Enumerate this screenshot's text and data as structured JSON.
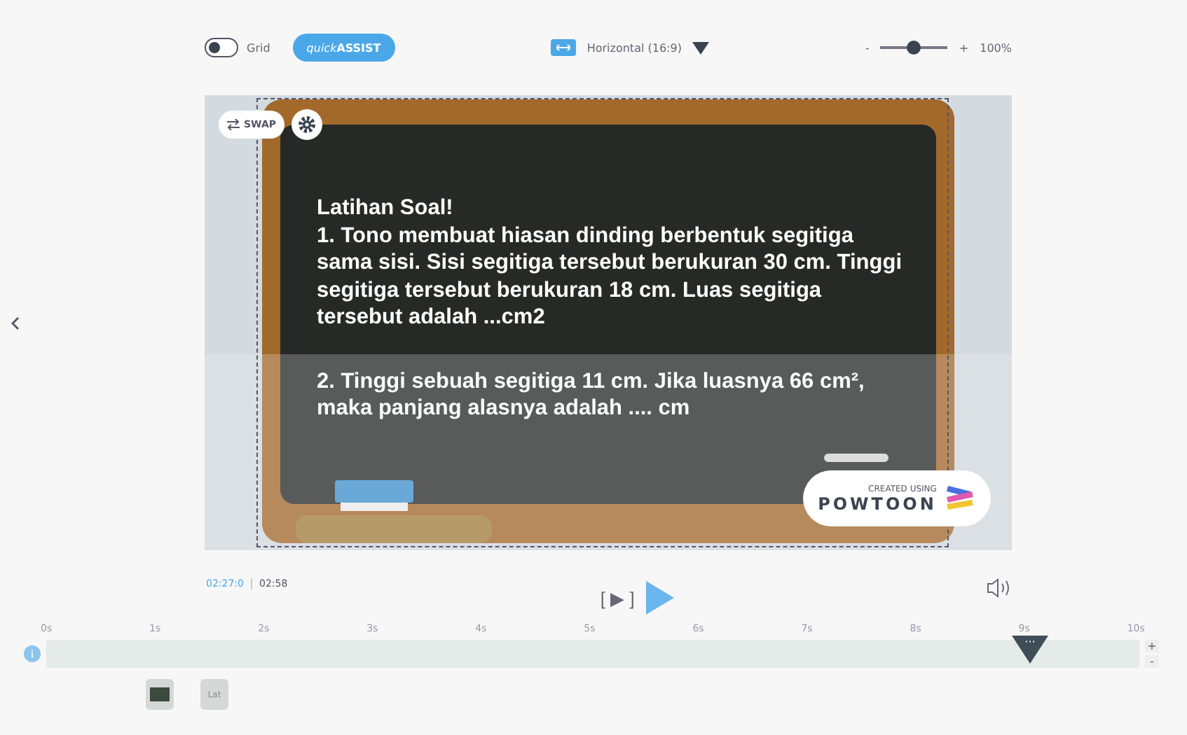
{
  "toolbar": {
    "grid_toggle": {
      "label": "Grid",
      "on": false
    },
    "assist_button": {
      "prefix": "quick",
      "label": "ASSIST"
    },
    "orientation": {
      "label": "Horizontal (16:9)"
    },
    "zoom": {
      "minus": "-",
      "plus": "+",
      "level": 0.5,
      "reading": "100%"
    }
  },
  "stage": {
    "swap_button": "SWAP",
    "slide_texts": [
      {
        "kind": "title",
        "text": "Latihan Soal!"
      },
      {
        "kind": "body",
        "text": "1. Tono membuat hiasan dinding berbentuk segitiga sama sisi. Sisi segitiga tersebut berukuran 30 cm. Tinggi segitiga tersebut berukuran 18 cm. Luas segitiga tersebut adalah ...cm2"
      },
      {
        "kind": "gap",
        "text": "2. Tinggi sebuah segitiga 11 cm. Jika luasnya 66 cm², maka panjang alasnya adalah .... cm"
      }
    ],
    "badge": {
      "caption": "CREATED USING",
      "brand": "POWTOON"
    }
  },
  "player": {
    "current_time": "02:27:0",
    "total_time": "02:58",
    "preview_button": "[ ▶ ]"
  },
  "timeline": {
    "ticks": [
      "0s",
      "1s",
      "2s",
      "3s",
      "4s",
      "5s",
      "6s",
      "7s",
      "8s",
      "9s",
      "10s"
    ],
    "playhead_label": "···",
    "zoom_in": "+",
    "zoom_out": "-",
    "info": "i",
    "clips": [
      {
        "kind": "image"
      },
      {
        "kind": "text",
        "label": "Lat"
      }
    ]
  }
}
